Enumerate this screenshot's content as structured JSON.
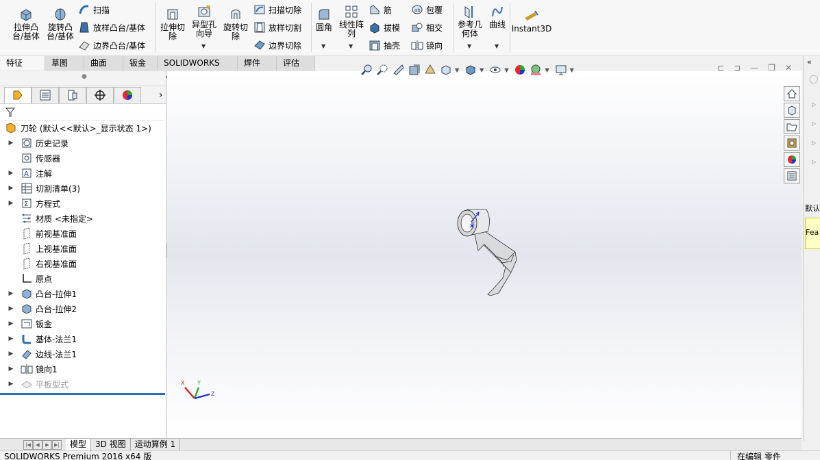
{
  "ribbon": {
    "extrude_boss": "拉伸凸\n台/基体",
    "revolve_boss": "旋转凸\n台/基体",
    "sweep": "扫描",
    "loft_boss": "放样凸台/基体",
    "boundary_boss": "边界凸台/基体",
    "extrude_cut": "拉伸切\n除",
    "hole_wizard": "异型孔\n向导",
    "revolve_cut": "旋转切\n除",
    "swept_cut": "扫描切除",
    "lofted_cut": "放样切割",
    "boundary_cut": "边界切除",
    "fillet": "圆角",
    "linear_pattern": "线性阵\n列",
    "rib": "筋",
    "wrap": "包覆",
    "draft": "拔模",
    "intersect": "相交",
    "shell": "抽壳",
    "mirror": "镜向",
    "ref_geometry": "参考几\n何体",
    "curves": "曲线",
    "instant3d": "Instant3D"
  },
  "tabs": [
    "特征",
    "草图",
    "曲面",
    "钣金",
    "SOLIDWORKS MBD",
    "焊件(D)",
    "评估"
  ],
  "tree": {
    "root": "刀轮 (默认<<默认>_显示状态 1>)",
    "items": [
      {
        "label": "历史记录",
        "exp": "▶",
        "icon": "history-icon"
      },
      {
        "label": "传感器",
        "exp": "",
        "icon": "sensor-icon"
      },
      {
        "label": "注解",
        "exp": "▶",
        "icon": "annotation-icon"
      },
      {
        "label": "切割清单(3)",
        "exp": "▶",
        "icon": "cut-list-icon"
      },
      {
        "label": "方程式",
        "exp": "▶",
        "icon": "equation-icon"
      },
      {
        "label": "材质 <未指定>",
        "exp": "",
        "icon": "material-icon"
      },
      {
        "label": "前视基准面",
        "exp": "",
        "icon": "plane-icon"
      },
      {
        "label": "上视基准面",
        "exp": "",
        "icon": "plane-icon"
      },
      {
        "label": "右视基准面",
        "exp": "",
        "icon": "plane-icon"
      },
      {
        "label": "原点",
        "exp": "",
        "icon": "origin-icon"
      },
      {
        "label": "凸台-拉伸1",
        "exp": "▶",
        "icon": "extrude-icon"
      },
      {
        "label": "凸台-拉伸2",
        "exp": "▶",
        "icon": "extrude-icon"
      },
      {
        "label": "钣金",
        "exp": "▶",
        "icon": "sheet-metal-icon"
      },
      {
        "label": "基体-法兰1",
        "exp": "▶",
        "icon": "base-flange-icon"
      },
      {
        "label": "边线-法兰1",
        "exp": "▶",
        "icon": "edge-flange-icon"
      },
      {
        "label": "镜向1",
        "exp": "▶",
        "icon": "mirror-icon"
      },
      {
        "label": "平板型式",
        "exp": "▶",
        "icon": "flat-pattern-icon",
        "dim": true
      }
    ]
  },
  "bottom_tabs": [
    "模型",
    "3D 视图",
    "运动算例 1"
  ],
  "status": {
    "left": "SOLIDWORKS Premium 2016 x64 版",
    "right": "在编辑 零件"
  },
  "right_popup": {
    "line1": "默认",
    "line2": "Fea"
  },
  "triad": {
    "x": "X",
    "y": "Y",
    "z": "Z"
  }
}
